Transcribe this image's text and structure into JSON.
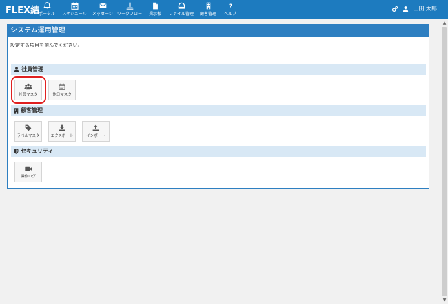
{
  "app": {
    "brand": "FLEX結"
  },
  "nav": [
    {
      "label": "ポータル",
      "icon": "bell-icon"
    },
    {
      "label": "スケジュール",
      "icon": "calendar-icon"
    },
    {
      "label": "メッセージ",
      "icon": "envelope-icon"
    },
    {
      "label": "ワークフロー",
      "icon": "workflow-icon"
    },
    {
      "label": "掲示板",
      "icon": "bulletin-icon"
    },
    {
      "label": "ファイル管理",
      "icon": "file-icon"
    },
    {
      "label": "顧客管理",
      "icon": "customer-icon"
    },
    {
      "label": "ヘルプ",
      "icon": "help-icon"
    }
  ],
  "user": {
    "name": "山田 太郎"
  },
  "panel": {
    "title": "システム運用管理",
    "instruction": "設定する項目を選んでください。"
  },
  "sections": [
    {
      "title": "社員管理",
      "icon": "user-icon",
      "tiles": [
        {
          "label": "社員マスタ",
          "icon": "users-icon",
          "highlighted": true
        },
        {
          "label": "休日マスタ",
          "icon": "calendar-icon",
          "highlighted": false
        }
      ]
    },
    {
      "title": "顧客管理",
      "icon": "building-icon",
      "tiles": [
        {
          "label": "ラベルマスタ",
          "icon": "tag-icon"
        },
        {
          "label": "エクスポート",
          "icon": "download-icon"
        },
        {
          "label": "インポート",
          "icon": "upload-icon"
        }
      ]
    },
    {
      "title": "セキュリティ",
      "icon": "shield-icon",
      "tiles": [
        {
          "label": "操作ログ",
          "icon": "video-camera-icon"
        }
      ]
    }
  ],
  "colors": {
    "topbar": "#1d7bbf",
    "panel_border": "#2e7fc1",
    "section_bg": "#d8e8f5",
    "highlight": "#e02020"
  }
}
